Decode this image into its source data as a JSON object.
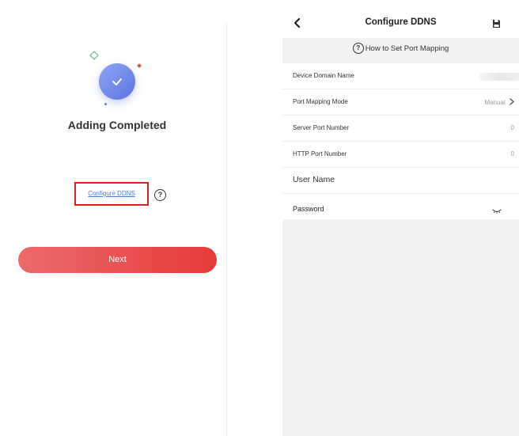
{
  "left_screen": {
    "title": "Adding Completed",
    "configure_ddns_link": "Configure DDNS",
    "help_icon": "?",
    "next_button": "Next"
  },
  "right_screen": {
    "nav_title": "Configure DDNS",
    "howto_text": "How to Set Port Mapping",
    "howto_icon": "?",
    "rows": {
      "device_domain": {
        "label": "Device Domain Name",
        "value": ""
      },
      "port_mapping_mode": {
        "label": "Port Mapping Mode",
        "value": "Manual"
      },
      "server_port": {
        "label": "Server Port Number",
        "value": "0"
      },
      "http_port": {
        "label": "HTTP Port Number",
        "value": "0"
      },
      "user_name": {
        "label": "User Name",
        "value": ""
      },
      "password": {
        "label": "Password",
        "value": ""
      }
    }
  },
  "icons": {
    "success": "check-circle-icon",
    "back": "chevron-left-icon",
    "save": "floppy-disk-icon",
    "help": "question-circle-icon",
    "chevron": "chevron-right-icon",
    "eye": "eye-closed-icon"
  },
  "colors": {
    "accent_red": "#e83a3a",
    "link_blue": "#4a7fd6",
    "success_blue": "#5a73e0",
    "highlight_box": "#e02020"
  }
}
